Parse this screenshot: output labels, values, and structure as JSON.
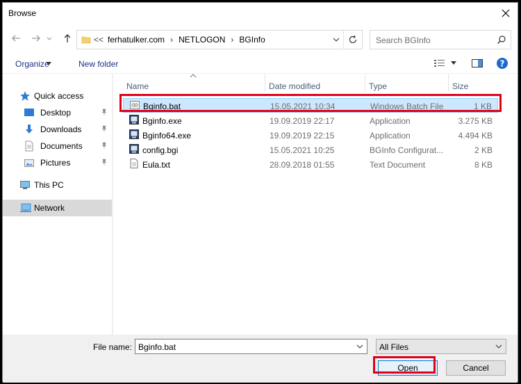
{
  "window": {
    "title": "Browse"
  },
  "address_bar": {
    "breadcrumbs": [
      "ferhatulker.com",
      "NETLOGON",
      "BGInfo"
    ],
    "overflow": "<<"
  },
  "search": {
    "placeholder": "Search BGInfo"
  },
  "toolbar": {
    "organize_label": "Organize",
    "new_folder_label": "New folder"
  },
  "nav_pane": {
    "items": [
      {
        "label": "Quick access",
        "icon": "star-icon"
      },
      {
        "label": "Desktop",
        "icon": "desktop-icon",
        "pinned": true
      },
      {
        "label": "Downloads",
        "icon": "download-icon",
        "pinned": true
      },
      {
        "label": "Documents",
        "icon": "documents-icon",
        "pinned": true
      },
      {
        "label": "Pictures",
        "icon": "pictures-icon",
        "pinned": true
      },
      {
        "label": "This PC",
        "icon": "computer-icon"
      },
      {
        "label": "Network",
        "icon": "network-icon",
        "selected": true
      }
    ]
  },
  "file_list": {
    "columns": [
      "Name",
      "Date modified",
      "Type",
      "Size"
    ],
    "rows": [
      {
        "name": "Bginfo.bat",
        "date": "15.05.2021 10:34",
        "type": "Windows Batch File",
        "size": "1 KB",
        "icon": "batch-file-icon",
        "selected": true
      },
      {
        "name": "Bginfo.exe",
        "date": "19.09.2019 22:17",
        "type": "Application",
        "size": "3.275 KB",
        "icon": "application-icon"
      },
      {
        "name": "Bginfo64.exe",
        "date": "19.09.2019 22:15",
        "type": "Application",
        "size": "4.494 KB",
        "icon": "application-icon"
      },
      {
        "name": "config.bgi",
        "date": "15.05.2021 10:25",
        "type": "BGInfo Configurat...",
        "size": "2 KB",
        "icon": "bginfo-config-icon"
      },
      {
        "name": "Eula.txt",
        "date": "28.09.2018 01:55",
        "type": "Text Document",
        "size": "8 KB",
        "icon": "text-file-icon"
      }
    ]
  },
  "bottom": {
    "file_name_label": "File name:",
    "file_name_value": "Bginfo.bat",
    "filter_value": "All Files",
    "open_label": "Open",
    "cancel_label": "Cancel"
  },
  "colors": {
    "highlight": "#e0001a",
    "selection": "#cce8ff",
    "link": "#1e3287",
    "help": "#1e68c9"
  }
}
